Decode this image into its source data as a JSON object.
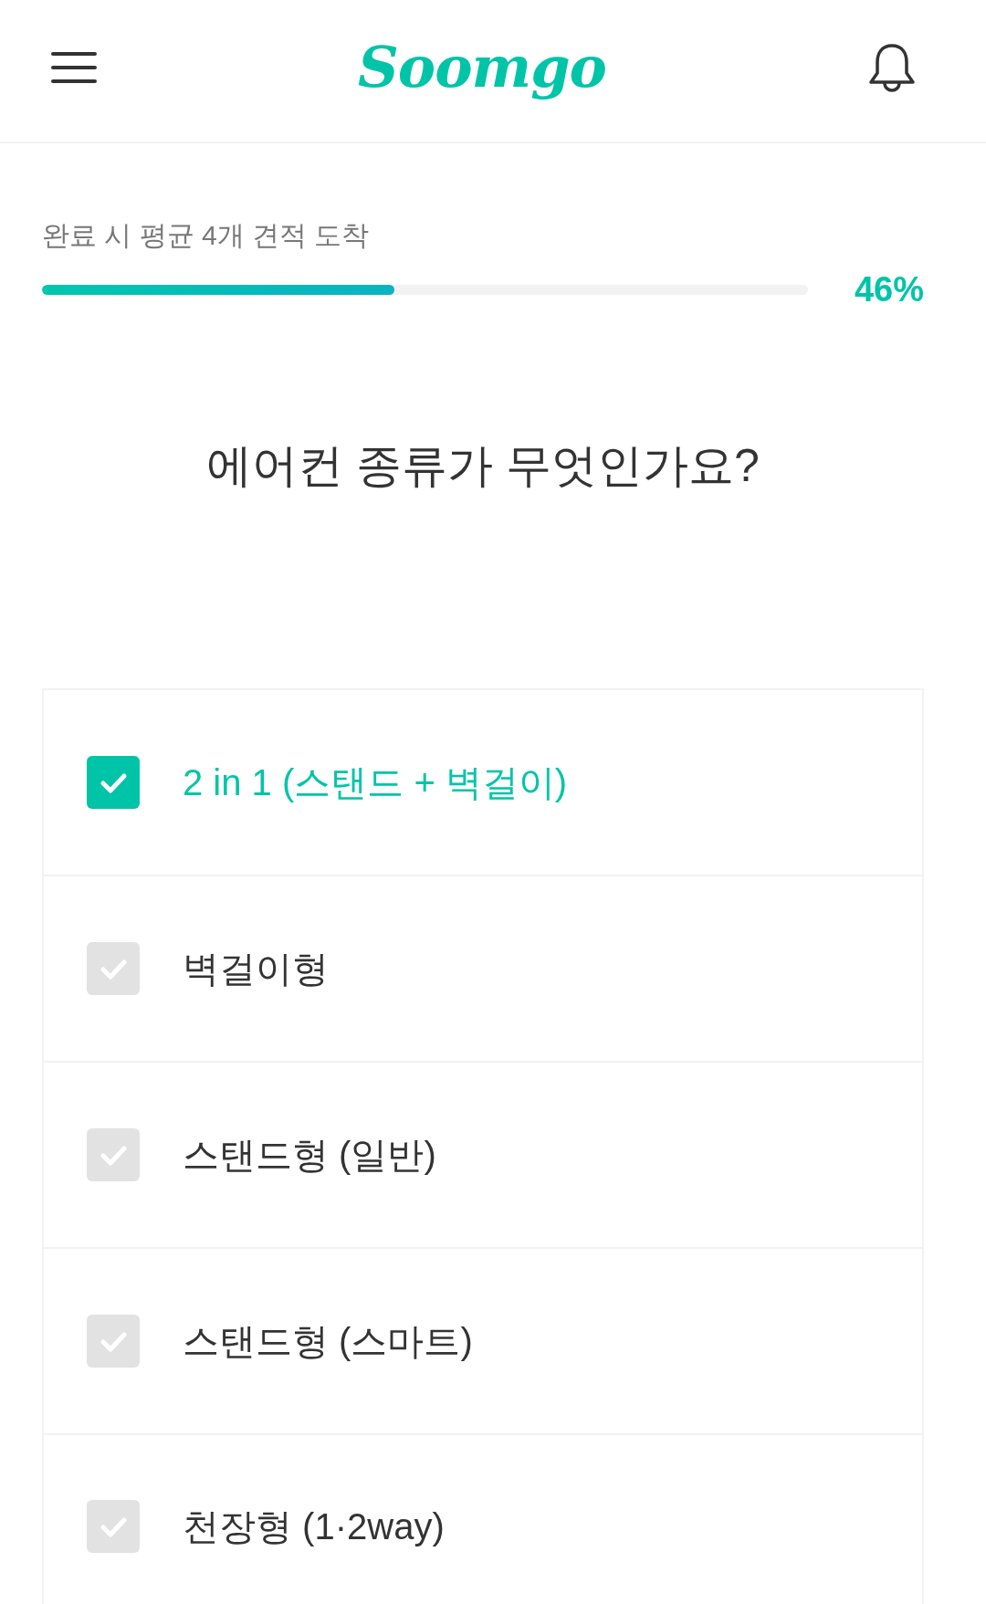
{
  "header": {
    "logo": "Soomgo"
  },
  "progress": {
    "caption": "완료 시 평균 4개 견적 도착",
    "level": 0.46,
    "percent": "46%"
  },
  "question": "에어컨 종류가 무엇인가요?",
  "options": [
    {
      "label": "2 in 1 (스탠드 + 벽걸이)",
      "checked": true
    },
    {
      "label": "벽걸이형",
      "checked": false
    },
    {
      "label": "스탠드형 (일반)",
      "checked": false
    },
    {
      "label": "스탠드형 (스마트)",
      "checked": false
    },
    {
      "label": "천장형 (1·2way)",
      "checked": false
    }
  ]
}
